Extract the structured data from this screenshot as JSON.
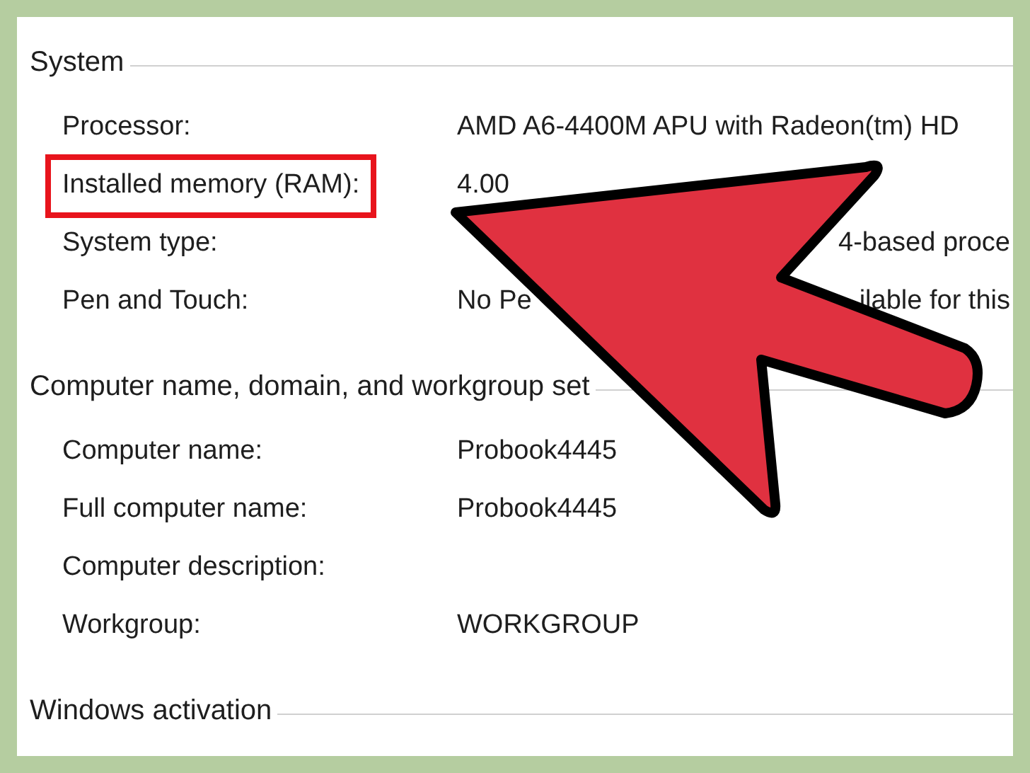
{
  "sections": [
    {
      "title": "System",
      "rows": [
        {
          "label": "Processor:",
          "value": "AMD A6-4400M APU with Radeon(tm) HD",
          "highlighted": false
        },
        {
          "label": "Installed memory (RAM):",
          "value": "4.00",
          "highlighted": true
        },
        {
          "label": "System type:",
          "value_tail": "4-based proce",
          "highlighted": false
        },
        {
          "label": "Pen and Touch:",
          "value": "No Pe",
          "value_tail": "ilable for this",
          "highlighted": false
        }
      ]
    },
    {
      "title": "Computer name, domain, and workgroup set",
      "rows": [
        {
          "label": "Computer name:",
          "value": "Probook4445",
          "highlighted": false
        },
        {
          "label": "Full computer name:",
          "value": "Probook4445",
          "highlighted": false
        },
        {
          "label": "Computer description:",
          "highlighted": false
        },
        {
          "label": "Workgroup:",
          "value": "WORKGROUP",
          "highlighted": false
        }
      ]
    },
    {
      "title": "Windows activation"
    }
  ]
}
